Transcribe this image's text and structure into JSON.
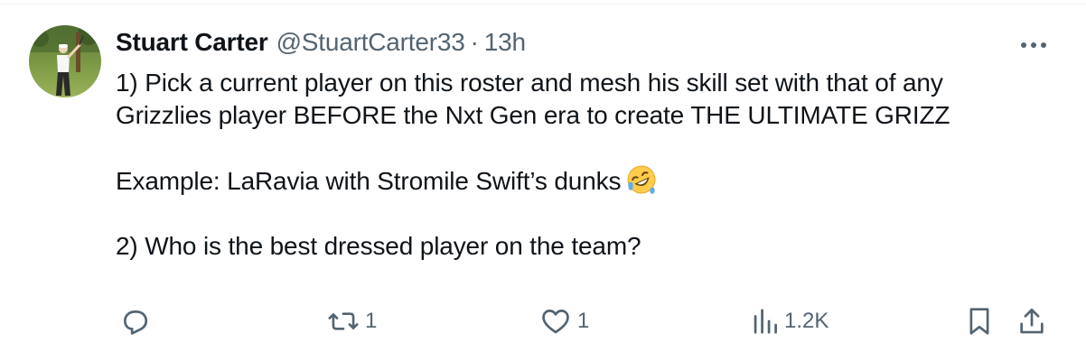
{
  "tweet": {
    "author_name": "Stuart Carter",
    "author_handle": "@StuartCarter33",
    "separator": "·",
    "time": "13h",
    "lines": [
      "1) Pick a current player on this roster and mesh his skill set with that of any",
      "Grizzlies player BEFORE the Nxt Gen era to create THE ULTIMATE GRIZZ",
      "Example: LaRavia with Stromile Swift’s dunks",
      "2) Who is the best dressed player on the team?"
    ],
    "emoji": "rolling-on-floor-laughing"
  },
  "actions": {
    "reply_count": "",
    "retweet_count": "1",
    "like_count": "1",
    "views_count": "1.2K"
  },
  "icons": {
    "avatar": "golfer-avatar",
    "more": "more-horizontal-icon",
    "reply": "reply-icon",
    "retweet": "retweet-icon",
    "like": "heart-icon",
    "views": "views-chart-icon",
    "bookmark": "bookmark-icon",
    "share": "share-icon"
  },
  "colors": {
    "text_primary": "#0f1419",
    "text_secondary": "#536471",
    "background": "#ffffff"
  }
}
